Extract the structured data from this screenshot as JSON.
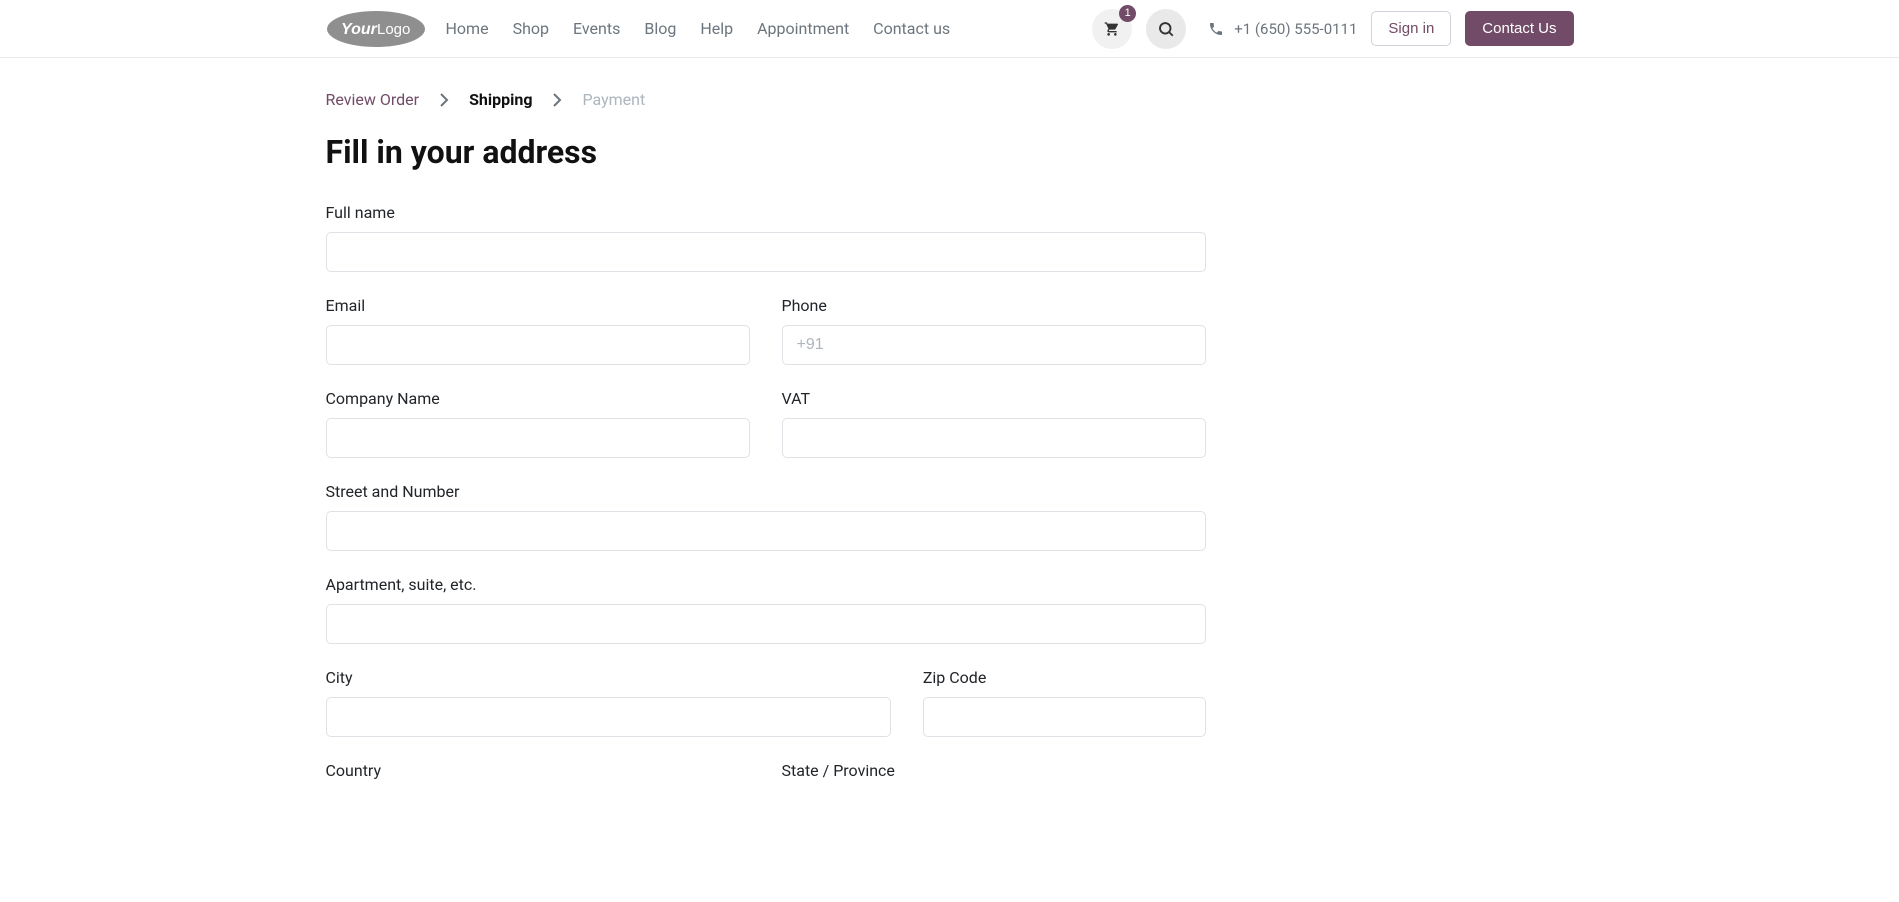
{
  "header": {
    "nav": {
      "home": "Home",
      "shop": "Shop",
      "events": "Events",
      "blog": "Blog",
      "help": "Help",
      "appointment": "Appointment",
      "contact": "Contact us"
    },
    "cart_count": "1",
    "phone": "+1 (650) 555-0111",
    "signin": "Sign in",
    "contact_us": "Contact Us"
  },
  "breadcrumb": {
    "review": "Review Order",
    "shipping": "Shipping",
    "payment": "Payment"
  },
  "title": "Fill in your address",
  "form": {
    "full_name": {
      "label": "Full name",
      "value": ""
    },
    "email": {
      "label": "Email",
      "value": ""
    },
    "phone": {
      "label": "Phone",
      "value": "",
      "placeholder": "+91"
    },
    "company": {
      "label": "Company Name",
      "value": ""
    },
    "vat": {
      "label": "VAT",
      "value": ""
    },
    "street": {
      "label": "Street and Number",
      "value": ""
    },
    "apartment": {
      "label": "Apartment, suite, etc.",
      "value": ""
    },
    "city": {
      "label": "City",
      "value": ""
    },
    "zip": {
      "label": "Zip Code",
      "value": ""
    },
    "country": {
      "label": "Country",
      "value": ""
    },
    "state": {
      "label": "State / Province",
      "value": ""
    }
  }
}
